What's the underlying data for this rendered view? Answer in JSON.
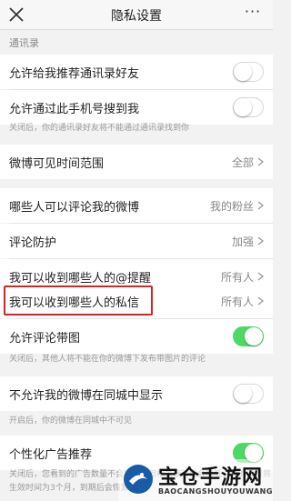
{
  "header": {
    "title": "隐私设置",
    "more_label": "···"
  },
  "sections": {
    "contacts_header": "通讯录"
  },
  "rows": {
    "recommend_contacts": {
      "label": "允许给我推荐通讯录好友",
      "toggle_on": false
    },
    "search_by_phone": {
      "label": "允许通过此手机号搜到我",
      "toggle_on": false
    },
    "weibo_visible_range": {
      "label": "微博可见时间范围",
      "value": "全部"
    },
    "who_can_comment": {
      "label": "哪些人可以评论我的微博",
      "value": "我的粉丝"
    },
    "comment_protection": {
      "label": "评论防护",
      "value": "加强"
    },
    "mentions_from": {
      "label": "我可以收到哪些人的@提醒",
      "value": "所有人"
    },
    "messages_from": {
      "label": "我可以收到哪些人的私信",
      "value": "所有人"
    },
    "comment_with_image": {
      "label": "允许评论带图",
      "toggle_on": true
    },
    "hide_in_same_city": {
      "label": "不允许我的微博在同城中显示",
      "toggle_on": false
    },
    "personalized_ads": {
      "label": "个性化广告推荐",
      "toggle_on": true
    }
  },
  "notes": {
    "contacts_note": "关闭后，你的通讯录好友将不能通过通讯录找到你",
    "image_comment_note": "关闭后，其他人将不能在你的微博下发布带图片的评论",
    "same_city_note": "开启后，你的微博在同城中不可见",
    "ads_note": "关闭后，您看到的广告数量不会减少，但相关度可能会降低，你的设置将",
    "ads_note_2": "生效时间为3个月，到期后会恢复"
  },
  "watermark": {
    "title": "宝仓手游网",
    "subtitle": "BAOCANGSHOUYOUWANG"
  },
  "colors": {
    "toggle_on": "#4cd964",
    "highlight": "#e02020"
  }
}
